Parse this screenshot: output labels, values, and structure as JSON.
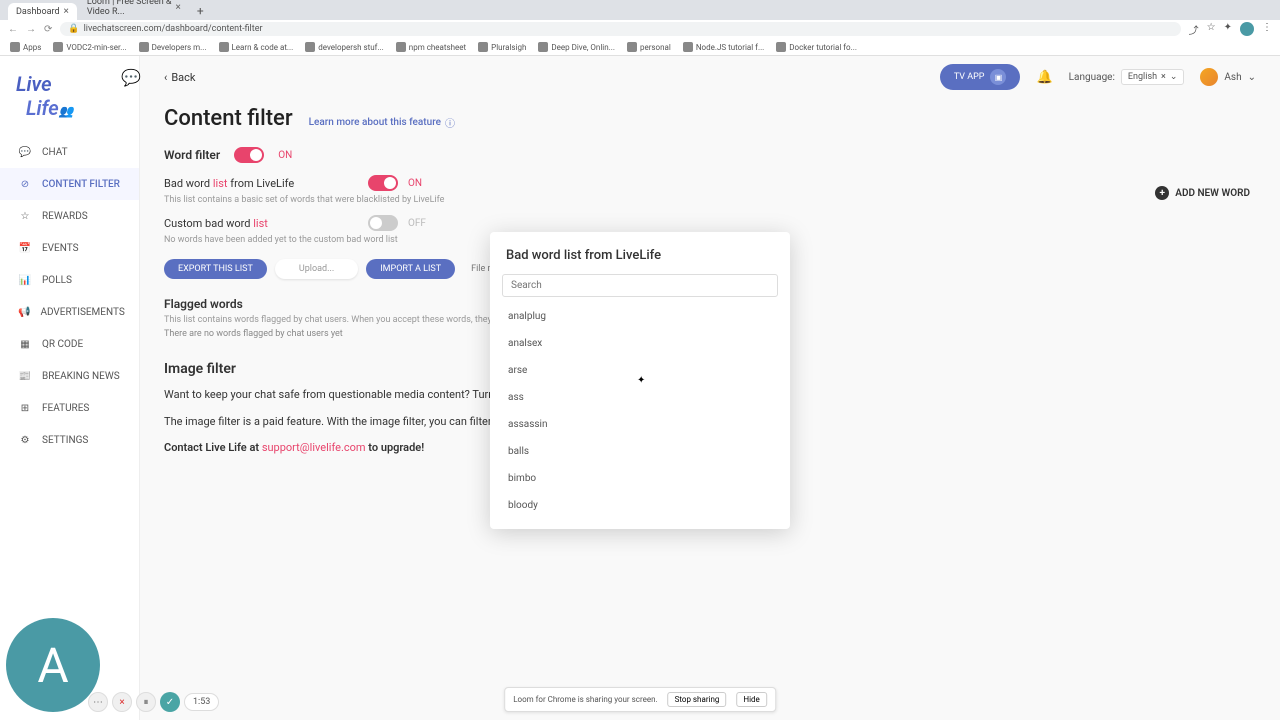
{
  "browser": {
    "tabs": [
      {
        "title": "Dashboard"
      },
      {
        "title": "Loom | Free Screen & Video R..."
      }
    ],
    "url": "livechatscreen.com/dashboard/content-filter",
    "bookmarks": [
      "Apps",
      "VODC2-min-ser...",
      "Developers m...",
      "Learn & code at...",
      "developersh stuf...",
      "npm cheatsheet",
      "Pluralsigh",
      "Deep Dive, Onlin...",
      "personal",
      "Node.JS tutorial f...",
      "Docker tutorial fo..."
    ]
  },
  "logo": {
    "line1": "Live",
    "line2": "Life"
  },
  "nav": {
    "items": [
      {
        "label": "CHAT"
      },
      {
        "label": "CONTENT FILTER"
      },
      {
        "label": "REWARDS"
      },
      {
        "label": "EVENTS"
      },
      {
        "label": "POLLS"
      },
      {
        "label": "ADVERTISEMENTS"
      },
      {
        "label": "QR CODE"
      },
      {
        "label": "BREAKING NEWS"
      },
      {
        "label": "FEATURES"
      },
      {
        "label": "SETTINGS"
      }
    ]
  },
  "topbar": {
    "back": "Back",
    "tv_app": "TV APP",
    "language_label": "Language:",
    "language_value": "English",
    "user_name": "Ash"
  },
  "page": {
    "title": "Content filter",
    "learn_more": "Learn more about this feature",
    "add_word": "ADD NEW WORD"
  },
  "word_filter": {
    "title": "Word filter",
    "state": "ON",
    "bad_list_prefix": "Bad word ",
    "bad_list_red": "list",
    "bad_list_suffix": " from LiveLife",
    "bad_state": "ON",
    "bad_desc": "This list contains a basic set of words that were blacklisted by LiveLife",
    "custom_label_prefix": "Custom bad word ",
    "custom_label_red": "list",
    "custom_state": "OFF",
    "custom_desc": "No words have been added yet to the custom bad word list",
    "export": "EXPORT THIS LIST",
    "upload": "Upload...",
    "import": "IMPORT A LIST",
    "file_hint": "File must b",
    "flagged_title": "Flagged words",
    "flagged_desc": "This list contains words flagged by chat users. When you accept these words, they will be",
    "flagged_empty": "There are no words flagged by chat users yet"
  },
  "image_filter": {
    "title": "Image filter",
    "p1": "Want to keep your chat safe from questionable media content? Turn on                                                                                      images.",
    "p2_prefix": "The image filter is a paid feature. With the image filter, you can filter ou                                                                              and violence.",
    "p3_prefix": "Contact Live Life at ",
    "p3_email": "support@livelife.com",
    "p3_suffix": " to upgrade!"
  },
  "modal": {
    "title": "Bad word list from LiveLife",
    "search_placeholder": "Search",
    "words": [
      "analplug",
      "analsex",
      "arse",
      "ass",
      "assassin",
      "balls",
      "bimbo",
      "bloody"
    ]
  },
  "loom": {
    "avatar_letter": "A",
    "time": "1:53",
    "share_msg": "Loom for Chrome is sharing your screen.",
    "stop": "Stop sharing",
    "hide": "Hide"
  }
}
